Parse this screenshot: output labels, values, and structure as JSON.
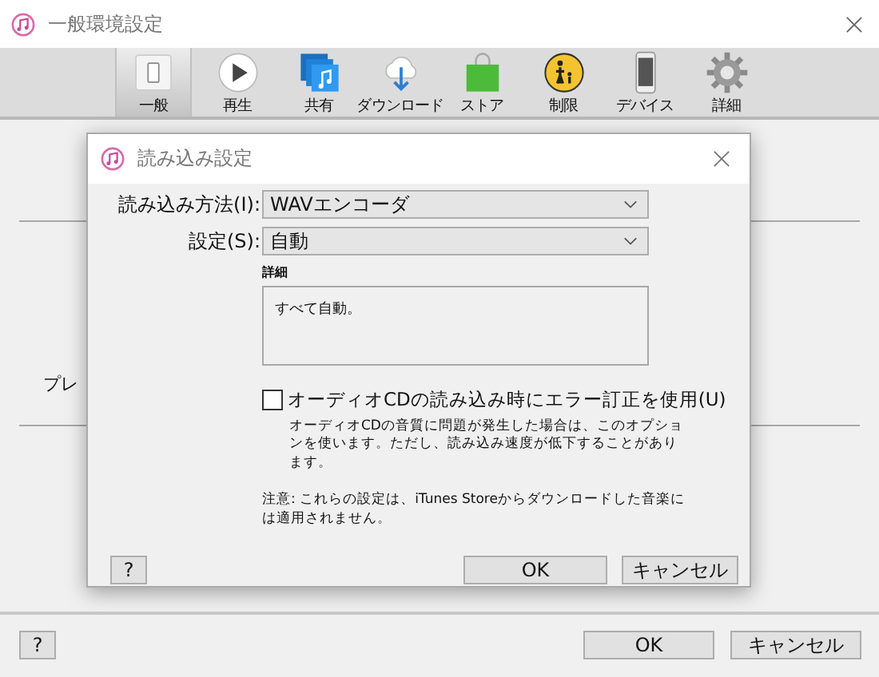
{
  "window": {
    "title": "一般環境設定"
  },
  "tabs": [
    {
      "label": "一般",
      "kind": "general",
      "selected": true
    },
    {
      "label": "再生",
      "kind": "playback",
      "selected": false
    },
    {
      "label": "共有",
      "kind": "sharing",
      "selected": false
    },
    {
      "label": "ダウンロード",
      "kind": "download",
      "selected": false
    },
    {
      "label": "ストア",
      "kind": "store",
      "selected": false
    },
    {
      "label": "制限",
      "kind": "restrictions",
      "selected": false
    },
    {
      "label": "デバイス",
      "kind": "devices",
      "selected": false
    },
    {
      "label": "詳細",
      "kind": "advanced",
      "selected": false
    }
  ],
  "background_label": "プレ",
  "dialog": {
    "title": "読み込み設定",
    "fields": [
      {
        "label": "読み込み方法(I):",
        "value": "WAVエンコーダ"
      },
      {
        "label": "設定(S):",
        "value": "自動"
      }
    ],
    "details_label": "詳細",
    "details_text": "すべて自動。",
    "error_correction": {
      "label": "オーディオCDの読み込み時にエラー訂正を使用(U)",
      "checked": false,
      "description": "オーディオCDの音質に問題が発生した場合は、このオプションを使います。ただし、読み込み速度が低下することがあります。"
    },
    "note": "注意: これらの設定は、iTunes Storeからダウンロードした音楽には適用されません。",
    "help": "?",
    "ok": "OK",
    "cancel": "キャンセル"
  },
  "footer": {
    "help": "?",
    "ok": "OK",
    "cancel": "キャンセル"
  }
}
